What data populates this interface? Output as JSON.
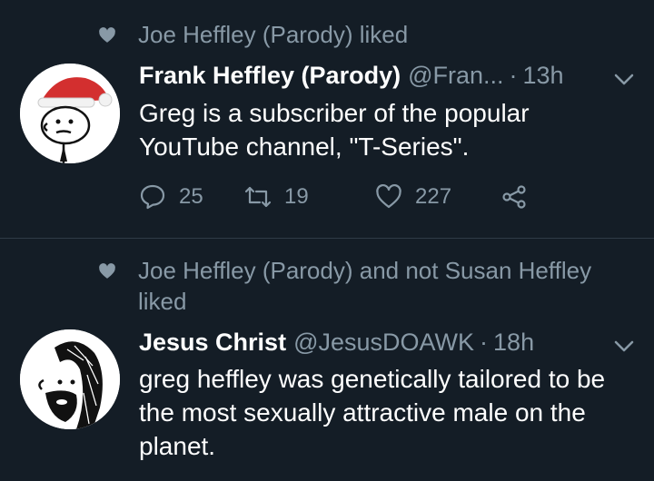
{
  "tweets": [
    {
      "social_context": "Joe Heffley (Parody) liked",
      "name": "Frank Heffley (Parody)",
      "handle": "@Fran...",
      "separator": "·",
      "time": "13h",
      "text": "Greg is a subscriber of the popular YouTube channel, \"T-Series\".",
      "replies": "25",
      "retweets": "19",
      "likes": "227"
    },
    {
      "social_context": "Joe Heffley (Parody) and not Susan Heffley liked",
      "name": "Jesus Christ",
      "handle": "@JesusDOAWK",
      "separator": "·",
      "time": "18h",
      "text": "greg heffley was genetically tailored to be the most sexually attractive male on the planet."
    }
  ],
  "icons": {
    "like_context": "heart-icon",
    "menu": "chevron-down-icon",
    "reply": "reply-icon",
    "retweet": "retweet-icon",
    "like": "heart-outline-icon",
    "share": "share-icon"
  },
  "colors": {
    "background": "#141d26",
    "secondary_text": "#8899a6",
    "divider": "#2f3b47"
  }
}
